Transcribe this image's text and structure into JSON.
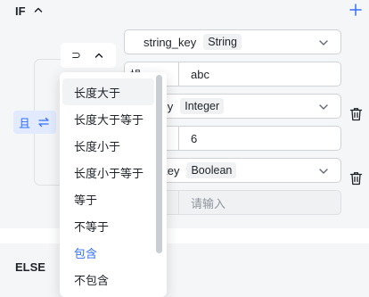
{
  "if_section": {
    "title": "IF",
    "collapse_icon": "chevron-up-icon",
    "add_icon": "plus-icon"
  },
  "logic": {
    "label": "且",
    "icon": "switch-icon"
  },
  "operator": {
    "value": "⊃",
    "icon": "chevron-up-icon"
  },
  "conditions": [
    {
      "variable": "string_key",
      "type": "Integer_placeholder_unused",
      "type_label": "String",
      "value_prefix": "操…",
      "value": "abc"
    },
    {
      "variable": "…key",
      "type_label": "Integer",
      "value_prefix": "",
      "value": "6"
    },
    {
      "variable": "…_key",
      "type_label": "Boolean",
      "value_prefix": "",
      "value": "",
      "placeholder": "请输入",
      "disabled": true
    }
  ],
  "dropdown": {
    "options": [
      "长度大于",
      "长度大于等于",
      "长度小于",
      "长度小于等于",
      "等于",
      "不等于",
      "包含",
      "不包含"
    ],
    "hovered_index": 0,
    "selected_index": 6
  },
  "else_section": {
    "title": "ELSE"
  },
  "colors": {
    "accent": "#3370ff",
    "panel_bg": "#f5f6f7",
    "chip_bg": "#e1eaff"
  }
}
